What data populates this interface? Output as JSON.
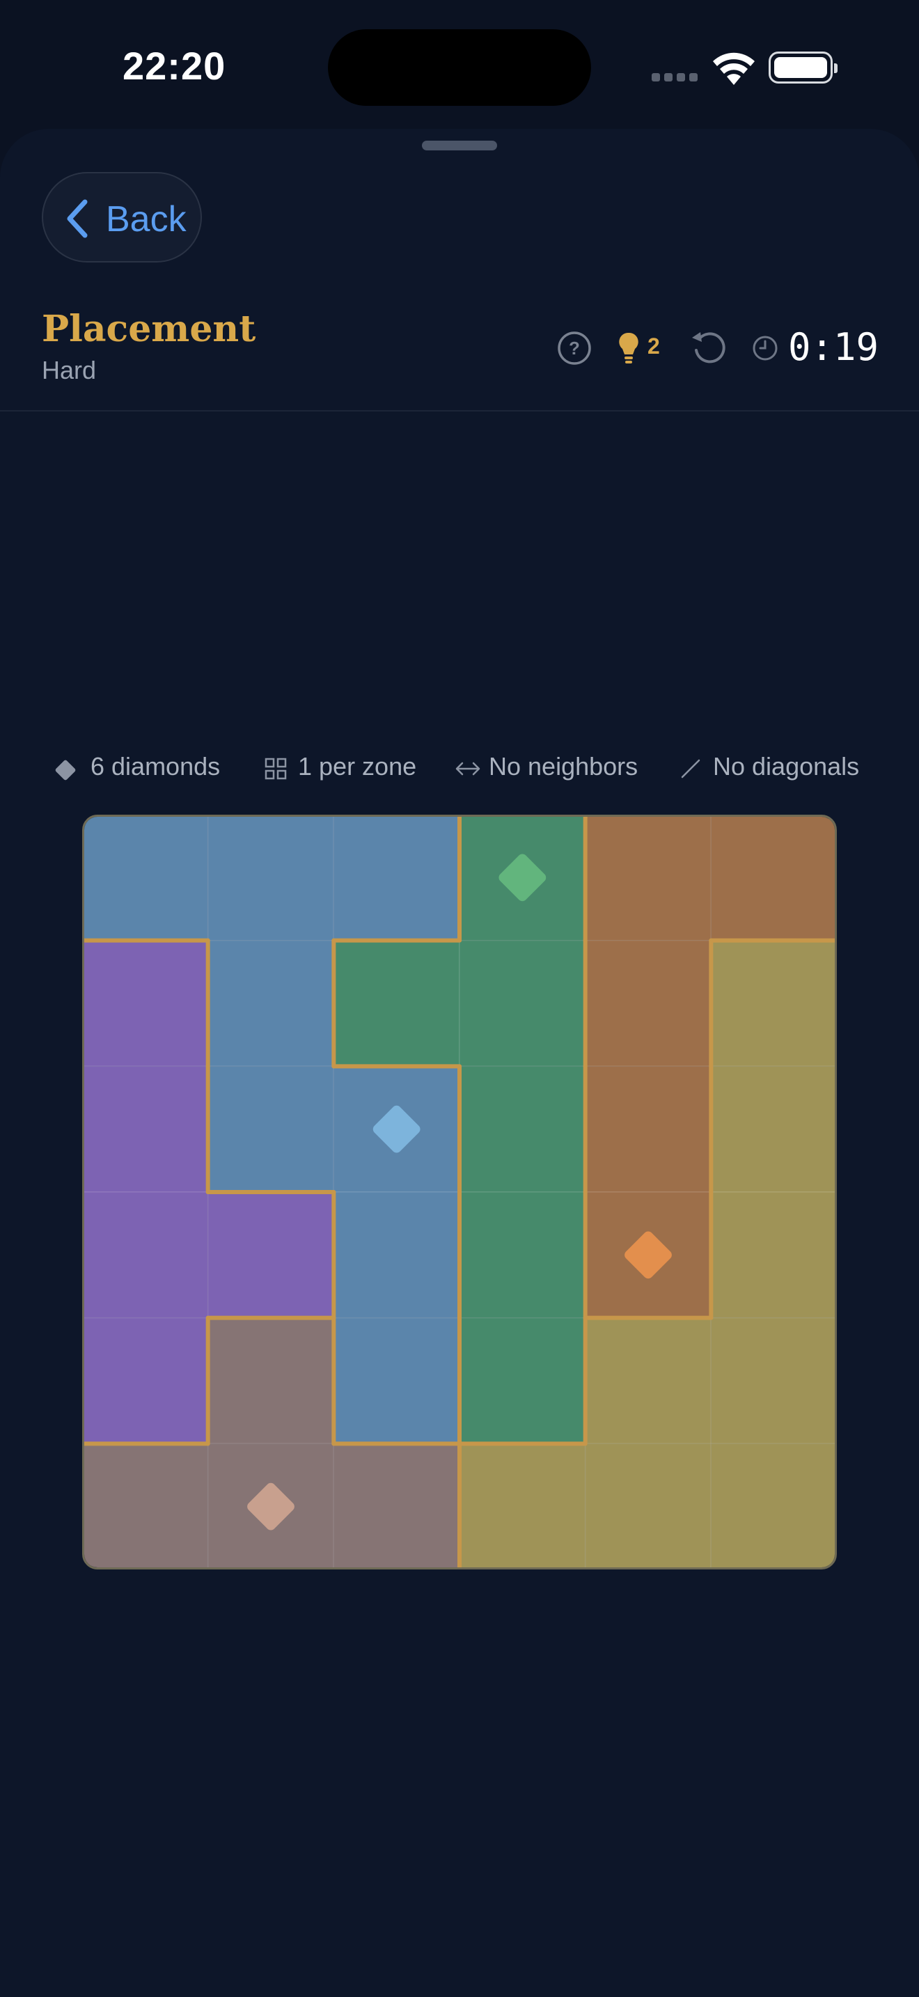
{
  "status": {
    "time": "22:20"
  },
  "header": {
    "back_label": "Back",
    "title": "Placement",
    "difficulty": "Hard",
    "hints_remaining": "2",
    "timer": "0:19"
  },
  "rules": [
    {
      "icon": "diamond-icon",
      "label": "6 diamonds"
    },
    {
      "icon": "zone-grid-icon",
      "label": "1 per zone"
    },
    {
      "icon": "arrows-horizontal-icon",
      "label": "No neighbors"
    },
    {
      "icon": "diagonal-slash-icon",
      "label": "No diagonals"
    }
  ],
  "board": {
    "size": 6,
    "zones": [
      [
        0,
        0,
        0,
        1,
        2,
        2
      ],
      [
        3,
        0,
        1,
        1,
        2,
        4
      ],
      [
        3,
        0,
        0,
        1,
        2,
        4
      ],
      [
        3,
        3,
        0,
        1,
        2,
        4
      ],
      [
        3,
        5,
        0,
        1,
        4,
        4
      ],
      [
        5,
        5,
        5,
        4,
        4,
        4
      ]
    ],
    "zone_colors": [
      "#5b85ab",
      "#468a6b",
      "#9d6f4a",
      "#7d63b3",
      "#9f9357",
      "#867474"
    ],
    "diamond_colors": [
      "#7db4dc",
      "#62b57d",
      "#e38f4d",
      "#9b80d8",
      "#c8b86b",
      "#c8a08e"
    ],
    "diamonds": [
      {
        "row": 0,
        "col": 3,
        "zone": 1
      },
      {
        "row": 2,
        "col": 2,
        "zone": 0
      },
      {
        "row": 3,
        "col": 4,
        "zone": 2
      },
      {
        "row": 5,
        "col": 1,
        "zone": 5
      }
    ],
    "border_color": "#c7974a"
  }
}
